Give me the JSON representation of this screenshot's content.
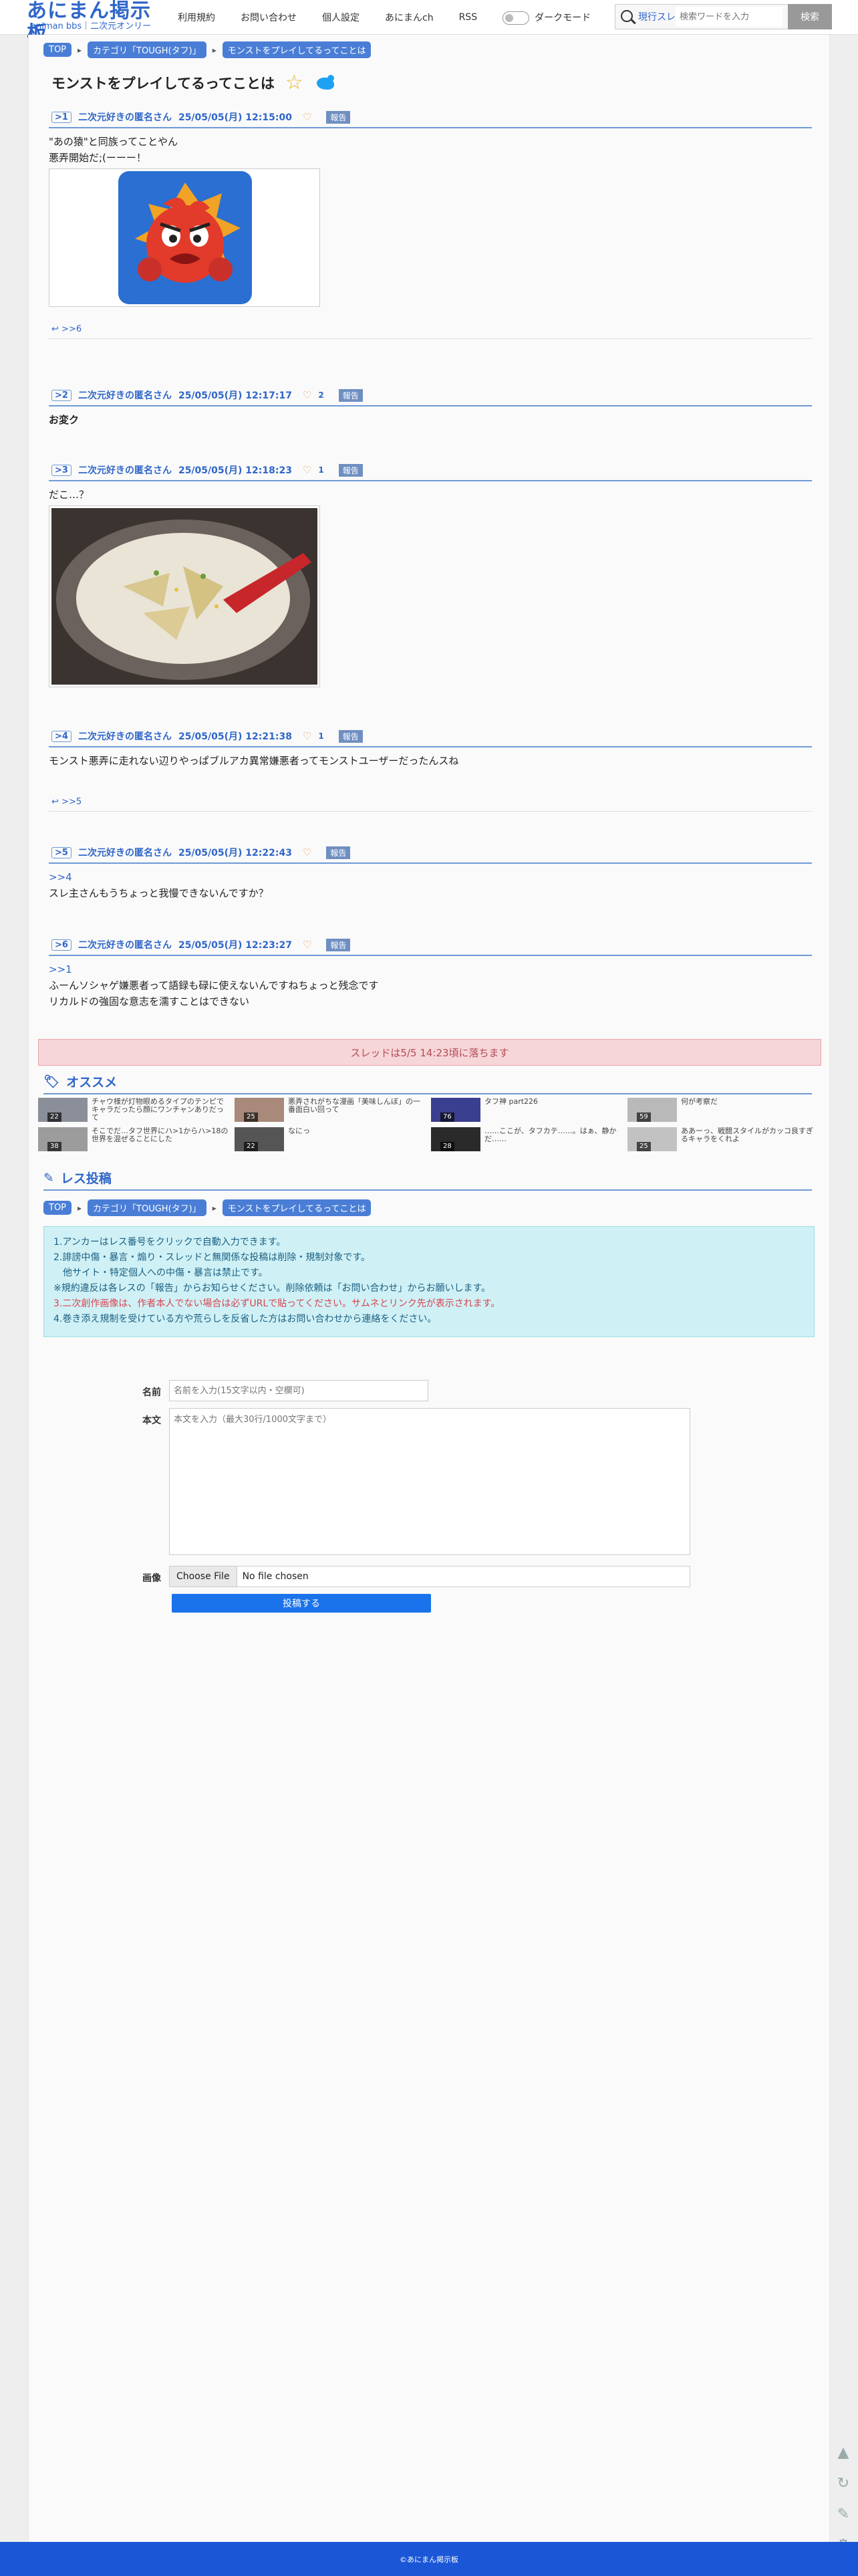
{
  "header": {
    "logo_main": "あにまん掲示板",
    "logo_sub": "animan bbs｜二次元オンリー",
    "nav": [
      "利用規約",
      "お問い合わせ",
      "個人設定",
      "あにまんch",
      "RSS"
    ],
    "dark_mode_label": "ダークモード",
    "search_mode": "現行スレ",
    "search_placeholder": "検索ワードを入力",
    "search_button": "検索"
  },
  "breadcrumb": [
    "TOP",
    "カテゴリ「TOUGH(タフ)」",
    "モンストをプレイしてるってことは"
  ],
  "thread_title": "モンストをプレイしてるってことは",
  "posts": [
    {
      "num": ">1",
      "name": "二次元好きの匿名さん",
      "date": "25/05/05(月) 12:15:00",
      "likes": "",
      "report": "報告",
      "lines": [
        "\"あの猿\"と同族ってことやん",
        "悪弄開始だ;(ーーー！"
      ],
      "replies": ">>6"
    },
    {
      "num": ">2",
      "name": "二次元好きの匿名さん",
      "date": "25/05/05(月) 12:17:17",
      "likes": "2",
      "report": "報告",
      "lines": [
        "お変ク"
      ]
    },
    {
      "num": ">3",
      "name": "二次元好きの匿名さん",
      "date": "25/05/05(月) 12:18:23",
      "likes": "1",
      "report": "報告",
      "lines": [
        "だこ…？"
      ]
    },
    {
      "num": ">4",
      "name": "二次元好きの匿名さん",
      "date": "25/05/05(月) 12:21:38",
      "likes": "1",
      "report": "報告",
      "lines": [
        "モンスト悪弄に走れない辺りやっぱブルアカ異常嫌悪者ってモンストユーザーだったんスね"
      ],
      "replies": ">>5"
    },
    {
      "num": ">5",
      "name": "二次元好きの匿名さん",
      "date": "25/05/05(月) 12:22:43",
      "likes": "",
      "report": "報告",
      "anchor": ">>4",
      "lines": [
        "スレ主さんもうちょっと我慢できないんですか？"
      ]
    },
    {
      "num": ">6",
      "name": "二次元好きの匿名さん",
      "date": "25/05/05(月) 12:23:27",
      "likes": "",
      "report": "報告",
      "anchor": ">>1",
      "lines": [
        "ふーんソシャゲ嫌悪者って語録も碌に使えないんですねちょっと残念です",
        "リカルドの強固な意志を濡すことはできない"
      ]
    }
  ],
  "thread_notice": "スレッドは5/5 14:23頃に落ちます",
  "recommend": {
    "heading": "オススメ",
    "items": [
      {
        "text": "チャウ様が灯物眼めるタイプのテンピでキャラだったら顔にワンチャンありだって",
        "count": "22"
      },
      {
        "text": "悪弄されがちな漫画「美味しんぼ」の一番面白い回って",
        "count": "25"
      },
      {
        "text": "タフ神 part226",
        "count": "76"
      },
      {
        "text": "何が考察だ",
        "count": "59"
      },
      {
        "text": "そこでだ…タフ世界にハ>1からハ>18の世界を混ぜることにした",
        "count": "38"
      },
      {
        "text": "なにっ",
        "count": "22"
      },
      {
        "text": "……ここが、タフカテ……。はぁ、静かだ……",
        "count": "28"
      },
      {
        "text": "ああーっ、戦闘スタイルがカッコ良すぎるキャラをくれよ",
        "count": "25"
      }
    ]
  },
  "reply_form": {
    "heading": "レス投稿",
    "rules": [
      "1.アンカーはレス番号をクリックで自動入力できます。",
      "2.誹謗中傷・暴言・煽り・スレッドと無関係な投稿は削除・規制対象です。",
      "　他サイト・特定個人への中傷・暴言は禁止です。",
      "※規約違反は各レスの「報告」からお知らせください。削除依頼は「お問い合わせ」からお願いします。",
      "3.二次創作画像は、作者本人でない場合は必ずURLで貼ってください。サムネとリンク先が表示されます。",
      "4.巻き添え規制を受けている方や荒らしを反省した方はお問い合わせから連絡をください。"
    ],
    "name_label": "名前",
    "name_placeholder": "名前を入力(15文字以内・空欄可)",
    "body_label": "本文",
    "body_placeholder": "本文を入力（最大30行/1000文字まで）",
    "image_label": "画像",
    "choose_file": "Choose File",
    "no_file": "No file chosen",
    "submit": "投稿する"
  },
  "footer": "©あにまん掲示板"
}
